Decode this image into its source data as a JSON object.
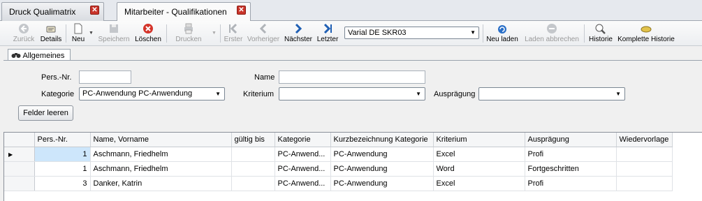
{
  "tabs": [
    {
      "label": "Druck Qualimatrix",
      "active": false
    },
    {
      "label": "Mitarbeiter - Qualifikationen",
      "active": true
    }
  ],
  "toolbar": {
    "back": "Zurück",
    "details": "Details",
    "new": "Neu",
    "save": "Speichern",
    "delete": "Löschen",
    "print": "Drucken",
    "first": "Erster",
    "previous": "Vorheriger",
    "next": "Nächster",
    "last": "Letzter",
    "variant_select": "Varial  DE SKR03",
    "reload": "Neu laden",
    "cancel_load": "Laden abbrechen",
    "history": "Historie",
    "full_history": "Komplette Historie"
  },
  "group_tab": {
    "label": "Allgemeines"
  },
  "filter": {
    "pers_nr_label": "Pers.-Nr.",
    "pers_nr_value": "",
    "name_label": "Name",
    "name_value": "",
    "kategorie_label": "Kategorie",
    "kategorie_value": "PC-Anwendung PC-Anwendung",
    "kriterium_label": "Kriterium",
    "kriterium_value": "",
    "auspraegung_label": "Ausprägung",
    "auspraegung_value": "",
    "clear_button": "Felder leeren"
  },
  "grid": {
    "columns": [
      "Pers.-Nr.",
      "Name, Vorname",
      "gültig bis",
      "Kategorie",
      "Kurzbezeichnung Kategorie",
      "Kriterium",
      "Ausprägung",
      "Wiedervorlage"
    ],
    "rows": [
      [
        "1",
        "Aschmann, Friedhelm",
        "",
        "PC-Anwend...",
        "PC-Anwendung",
        "Excel",
        "Profi",
        ""
      ],
      [
        "1",
        "Aschmann, Friedhelm",
        "",
        "PC-Anwend...",
        "PC-Anwendung",
        "Word",
        "Fortgeschritten",
        ""
      ],
      [
        "3",
        "Danker, Katrin",
        "",
        "PC-Anwend...",
        "PC-Anwendung",
        "Excel",
        "Profi",
        ""
      ]
    ]
  },
  "colors": {
    "accent": "#1f5fb4",
    "close": "#c9342a",
    "selection": "#cde6fb"
  }
}
